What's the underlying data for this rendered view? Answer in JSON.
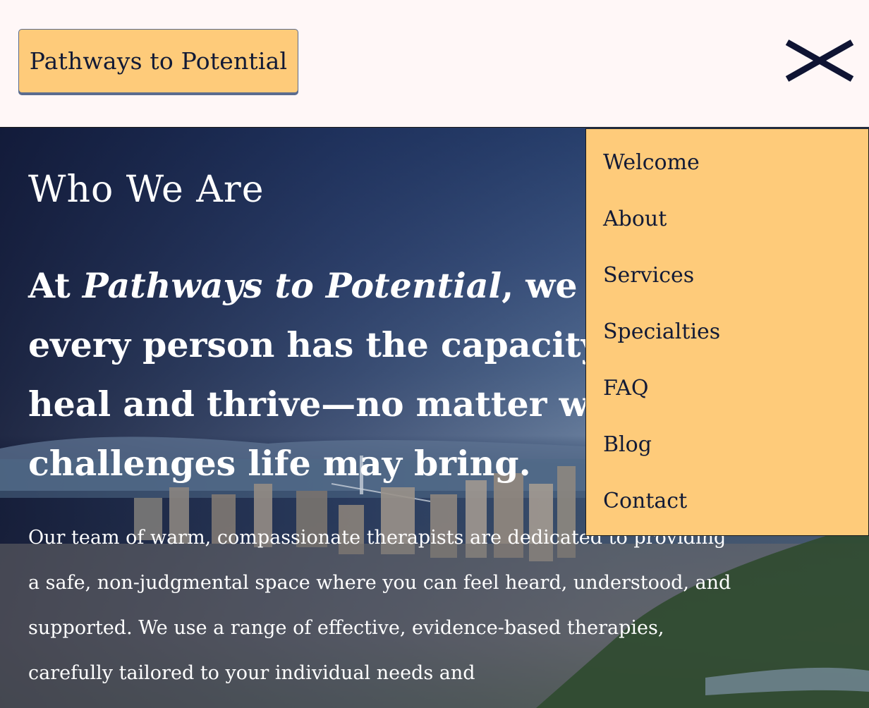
{
  "header": {
    "brand_label": "Pathways to Potential",
    "close_icon": "close-icon"
  },
  "nav": {
    "items": [
      {
        "label": "Welcome"
      },
      {
        "label": "About"
      },
      {
        "label": "Services"
      },
      {
        "label": "Specialties"
      },
      {
        "label": "FAQ"
      },
      {
        "label": "Blog"
      },
      {
        "label": "Contact"
      }
    ]
  },
  "hero": {
    "title": "Who We Are",
    "lead_prefix": "At ",
    "lead_emphasis": "Pathways to Potential",
    "lead_suffix": ", we believe every person has the capacity to heal and thrive—no matter what challenges life may bring.",
    "body": "Our team of warm, compassionate therapists are dedicated to providing a safe, non-judgmental space where you can feel heard, understood, and supported. We use a range of effective, evidence-based therapies, carefully tailored to your individual needs and"
  },
  "colors": {
    "accent": "#fecb7a",
    "background": "#fff7f7",
    "text_dark": "#121a36",
    "button_shadow": "#5b6c8f"
  }
}
